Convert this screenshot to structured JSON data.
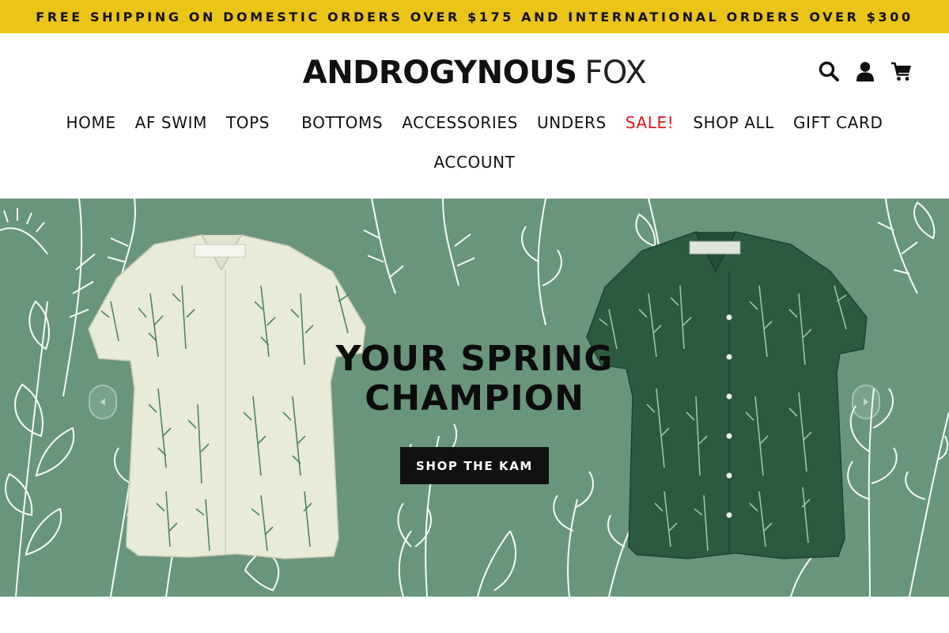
{
  "announcement": "FREE SHIPPING ON DOMESTIC ORDERS OVER $175 AND INTERNATIONAL ORDERS OVER $300",
  "header": {
    "logo": {
      "bold": "ANDROGYNOUS",
      "thin": "FOX"
    },
    "icons": [
      "search-icon",
      "account-icon",
      "cart-icon"
    ]
  },
  "nav": {
    "items": [
      {
        "label": "HOME"
      },
      {
        "label": "AF SWIM"
      },
      {
        "label": "TOPS"
      },
      {
        "label": "BOTTOMS"
      },
      {
        "label": "ACCESSORIES"
      },
      {
        "label": "UNDERS"
      },
      {
        "label": "SALE!"
      },
      {
        "label": "SHOP ALL"
      },
      {
        "label": "GIFT CARD"
      }
    ],
    "second_row": [
      {
        "label": "ACCOUNT"
      }
    ],
    "sale_color": "#e4161b"
  },
  "hero": {
    "title_line1": "YOUR SPRING",
    "title_line2": "CHAMPION",
    "cta": "SHOP THE KAM",
    "background_color": "#69967a",
    "left_shirt_color": "#e8ebd6",
    "right_shirt_color": "#2c5a3e"
  },
  "colors": {
    "announcement_bg": "#ebc417",
    "text": "#111111"
  }
}
